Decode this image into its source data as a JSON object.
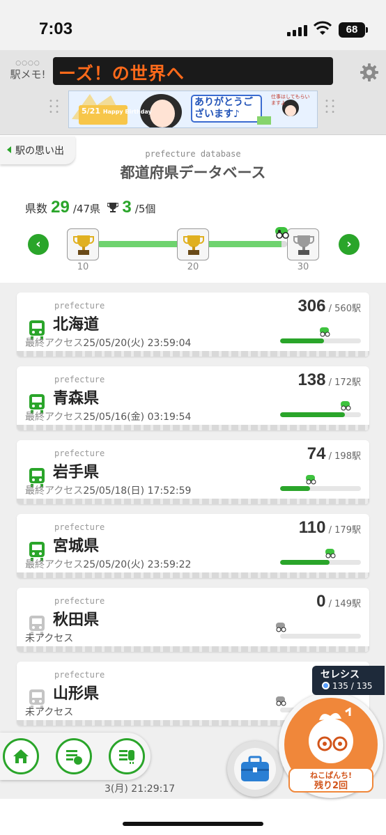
{
  "status_bar": {
    "time": "7:03",
    "battery": "68"
  },
  "header": {
    "logo_text": "駅メモ!",
    "logo_dots": "○○○○",
    "ticker_text": "ーズ！の世界へ",
    "banner": {
      "birthday_date": "5/21",
      "birthday_text": "Happy Birthday",
      "message": "ありがとうございます♪",
      "side_text": "仕事はしてもらいますよ"
    }
  },
  "back_label": "駅の思い出",
  "page": {
    "subtitle": "prefecture database",
    "title": "都道府県データベース",
    "pref_count_label": "県数",
    "pref_count": "29",
    "pref_total": "/47県",
    "trophy_count": "3",
    "trophy_total": "/5個",
    "progress_fraction": 0.97,
    "milestones": [
      {
        "label": "10",
        "achieved": true
      },
      {
        "label": "20",
        "achieved": true
      },
      {
        "label": "30",
        "achieved": false
      }
    ]
  },
  "list": {
    "caption": "prefecture",
    "access_prefix": "最終アクセス",
    "station_unit": "駅",
    "items": [
      {
        "name": "北海道",
        "access": "25/05/20(火) 23:59:04",
        "count": "306",
        "total": "560",
        "accessed": true
      },
      {
        "name": "青森県",
        "access": "25/05/16(金) 03:19:54",
        "count": "138",
        "total": "172",
        "accessed": true
      },
      {
        "name": "岩手県",
        "access": "25/05/18(日) 17:52:59",
        "count": "74",
        "total": "198",
        "accessed": true
      },
      {
        "name": "宮城県",
        "access": "25/05/20(火) 23:59:22",
        "count": "110",
        "total": "179",
        "accessed": true
      },
      {
        "name": "秋田県",
        "access": "未アクセス",
        "count": "0",
        "total": "149",
        "accessed": false
      },
      {
        "name": "山形県",
        "access": "未アクセス",
        "count": "",
        "total": "",
        "accessed": false
      }
    ],
    "partial_next_access": "3(月) 21:29:17"
  },
  "character_chip": {
    "name": "セレシス",
    "hp": "135 / 135"
  },
  "punch_button": {
    "line1": "ねこぱんち!",
    "line2": "残り2回"
  },
  "colors": {
    "accent_green": "#2aa52a",
    "punch_orange": "#f0873a",
    "ticker_text": "#ff6a1a"
  }
}
